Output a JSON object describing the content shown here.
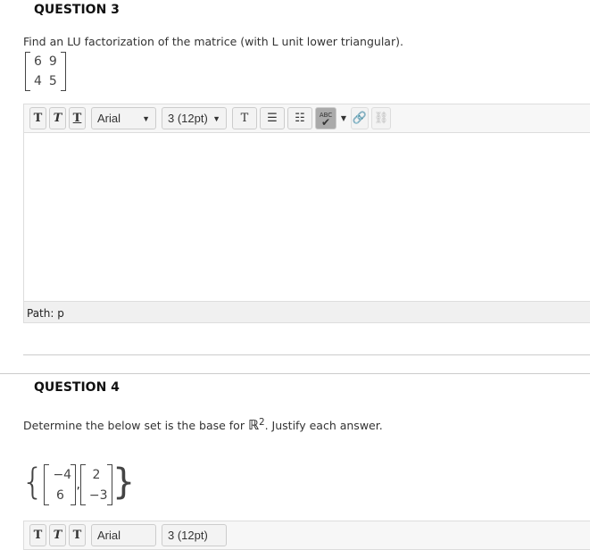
{
  "q3": {
    "title": "QUESTION 3",
    "text": "Find an LU factorization of the matrice (with L unit lower triangular).",
    "matrix": [
      [
        "6",
        "9"
      ],
      [
        "4",
        "5"
      ]
    ]
  },
  "toolbar": {
    "bold": "T",
    "italic": "T",
    "underline": "T",
    "font": "Arial",
    "size": "3 (12pt)",
    "text_color": "T",
    "spell": "ABC"
  },
  "editor": {
    "path_label": "Path: p"
  },
  "q4": {
    "title": "QUESTION 4",
    "text_before": "Determine the below set is the base for ",
    "field": "ℝ",
    "exp": "2",
    "text_after": ". Justify each answer.",
    "vectors": [
      [
        "−4",
        "6"
      ],
      [
        "2",
        "−3"
      ]
    ]
  }
}
